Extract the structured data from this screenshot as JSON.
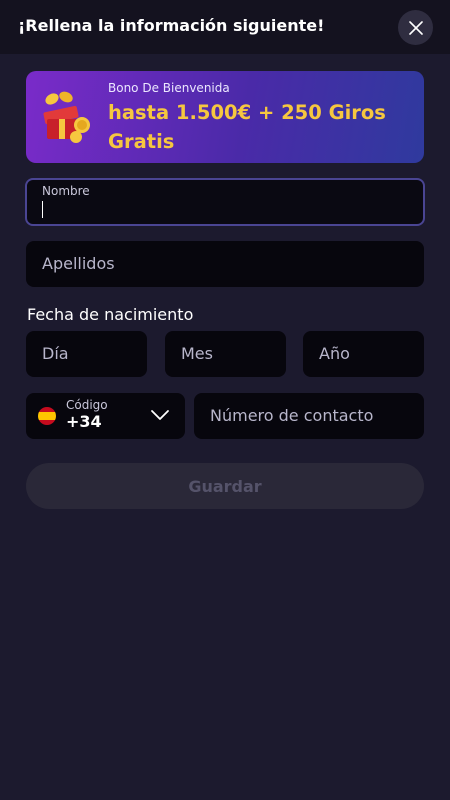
{
  "header": {
    "title": "¡Rellena la información siguiente!"
  },
  "bonus": {
    "subtitle": "Bono De Bienvenida",
    "headline": "hasta 1.500€ + 250 Giros Gratis"
  },
  "form": {
    "first_name": {
      "label": "Nombre",
      "value": ""
    },
    "last_name": {
      "placeholder": "Apellidos"
    },
    "birth_date": {
      "label": "Fecha de nacimiento",
      "day_placeholder": "Día",
      "month_placeholder": "Mes",
      "year_placeholder": "Año"
    },
    "phone": {
      "code_label": "Código",
      "code_value": "+34",
      "flag_icon": "spain-flag-icon",
      "number_placeholder": "Número de contacto"
    },
    "save_label": "Guardar"
  },
  "colors": {
    "background": "#1c1a2e",
    "field_background": "#07060d",
    "accent_yellow": "#f6c73f",
    "disabled_button": "#2a2838"
  }
}
